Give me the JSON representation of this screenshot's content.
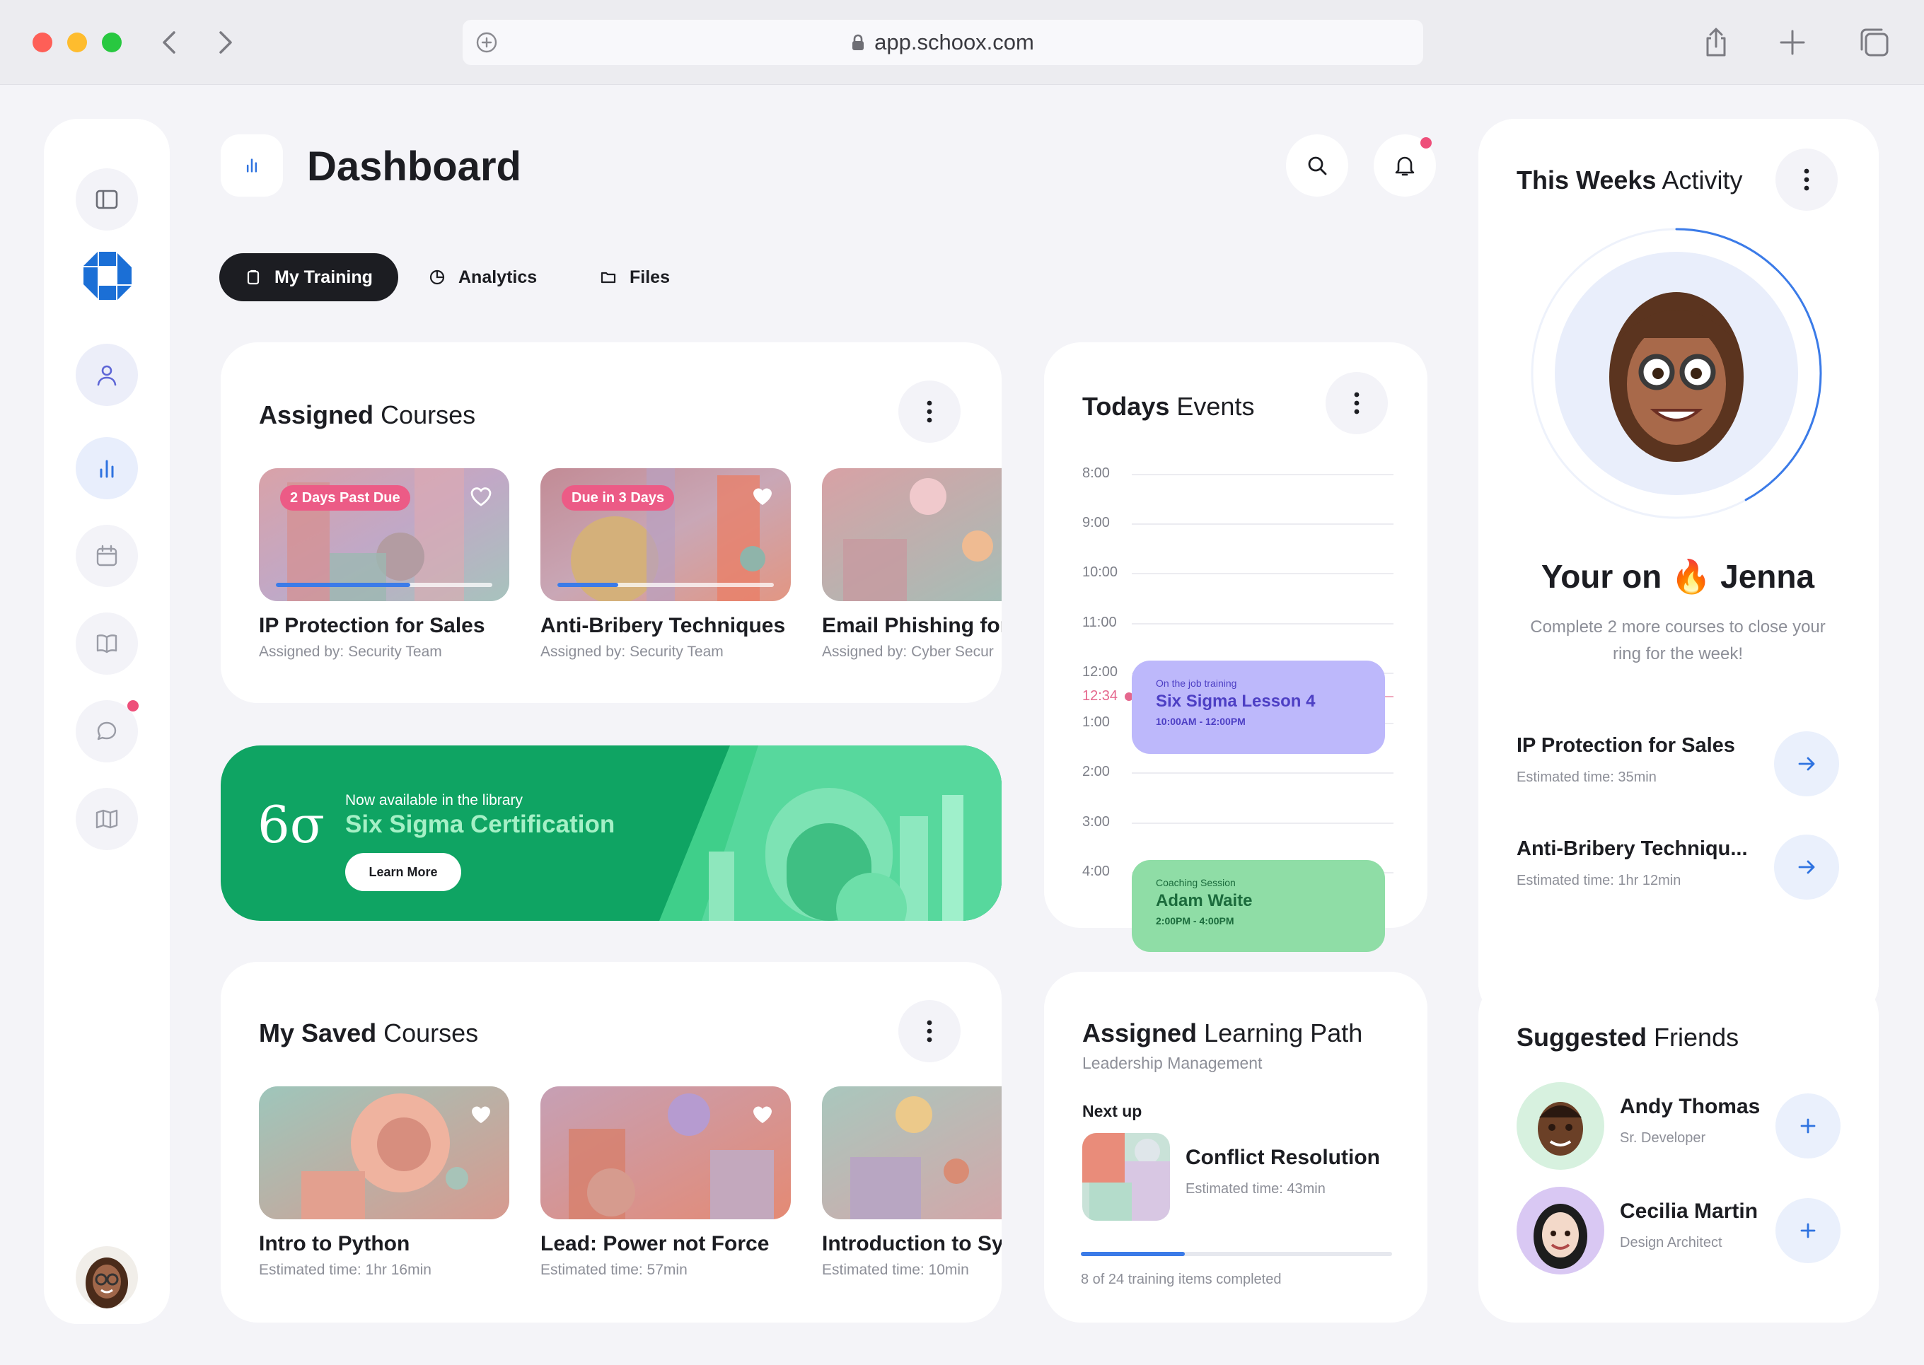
{
  "browser": {
    "url": "app.schoox.com"
  },
  "header": {
    "title": "Dashboard"
  },
  "tabs": [
    {
      "label": "My Training",
      "icon": "clipboard-icon",
      "active": true
    },
    {
      "label": "Analytics",
      "icon": "pie-chart-icon",
      "active": false
    },
    {
      "label": "Files",
      "icon": "folder-icon",
      "active": false
    }
  ],
  "assigned_courses": {
    "title_bold": "Assigned",
    "title_rest": "Courses",
    "items": [
      {
        "name": "IP Protection for Sales",
        "sub": "Assigned by: Security Team",
        "badge": "2 Days Past Due",
        "favorited": false,
        "progress": 0.62
      },
      {
        "name": "Anti-Bribery Techniques",
        "sub": "Assigned by: Security Team",
        "badge": "Due in 3 Days",
        "favorited": true,
        "progress": 0.28
      },
      {
        "name": "Email Phishing for",
        "sub": "Assigned by: Cyber Secur",
        "badge": "",
        "favorited": false,
        "progress": null
      }
    ]
  },
  "promo": {
    "logo": "6σ",
    "kicker": "Now available in the library",
    "title": "Six Sigma Certification",
    "button": "Learn More"
  },
  "saved_courses": {
    "title_bold": "My Saved",
    "title_rest": "Courses",
    "items": [
      {
        "name": "Intro to Python",
        "sub": "Estimated time: 1hr 16min",
        "favorited": true
      },
      {
        "name": "Lead: Power not Force",
        "sub": "Estimated time: 57min",
        "favorited": true
      },
      {
        "name": "Introduction to Sy",
        "sub": "Estimated time: 10min",
        "favorited": false
      }
    ]
  },
  "events": {
    "title_bold": "Todays",
    "title_rest": "Events",
    "times": [
      "8:00",
      "9:00",
      "10:00",
      "11:00",
      "12:00",
      "1:00",
      "2:00",
      "3:00",
      "4:00"
    ],
    "now_label": "12:34",
    "items": [
      {
        "kicker": "On the job training",
        "title": "Six Sigma Lesson 4",
        "time": "10:00AM - 12:00PM",
        "color": "#bdb8fb",
        "text_color": "#4d3fc4"
      },
      {
        "kicker": "Coaching Session",
        "title": "Adam Waite",
        "time": "2:00PM - 4:00PM",
        "color": "#8fdda6",
        "text_color": "#1b6b3c"
      }
    ]
  },
  "learning_path": {
    "title_bold": "Assigned",
    "title_rest": "Learning Path",
    "subtitle": "Leadership Management",
    "next_label": "Next up",
    "next_title": "Conflict Resolution",
    "next_sub": "Estimated time: 43min",
    "completed": 8,
    "total": 24,
    "progress_text": "8 of 24 training items completed"
  },
  "activity": {
    "title_bold": "This Weeks",
    "title_rest": "Activity",
    "greeting_pre": "Your on",
    "greeting_emoji": "🔥",
    "greeting_name": "Jenna",
    "subtitle": "Complete 2 more courses to close your ring for the week!",
    "ring_progress": 0.42,
    "items": [
      {
        "title": "IP Protection for Sales",
        "sub": "Estimated time: 35min"
      },
      {
        "title": "Anti-Bribery Techniqu...",
        "sub": "Estimated time: 1hr 12min"
      }
    ]
  },
  "friends": {
    "title_bold": "Suggested",
    "title_rest": "Friends",
    "items": [
      {
        "name": "Andy Thomas",
        "role": "Sr. Developer"
      },
      {
        "name": "Cecilia Martin",
        "role": "Design Architect"
      }
    ]
  },
  "colors": {
    "accent": "#3b7be8",
    "dark": "#1c1d22",
    "promo": "#0fa463",
    "badge": "#ec5b86",
    "now_line": "#e5678d"
  }
}
